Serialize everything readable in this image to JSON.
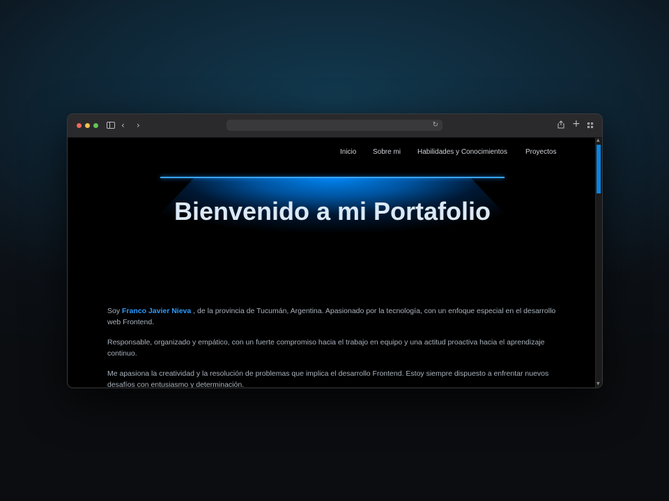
{
  "browser": {
    "url": "",
    "icons": {
      "back": "chevron-left-icon",
      "forward": "chevron-right-icon",
      "sidebar": "sidebar-icon",
      "reload": "reload-icon",
      "share": "share-icon",
      "new_tab": "plus-icon",
      "tab_overview": "tab-overview-icon"
    }
  },
  "nav": {
    "items": [
      "Inicio",
      "Sobre mi",
      "Habilidades y Conocimientos",
      "Proyectos"
    ]
  },
  "hero": {
    "title": "Bienvenido a mi Portafolio",
    "accent_color": "#1e90ff"
  },
  "about": {
    "p1_prefix": "Soy ",
    "p1_name": "Franco Javier Nieva",
    "p1_suffix": " , de la provincia de Tucumán, Argentina. Apasionado por la tecnología, con un enfoque especial en el desarrollo web Frontend.",
    "p2": "Responsable, organizado y empático, con un fuerte compromiso hacia el trabajo en equipo y una actitud proactiva hacia el aprendizaje continuo.",
    "p3": "Me apasiona la creatividad y la resolución de problemas que implica el desarrollo Frontend. Estoy siempre dispuesto a enfrentar nuevos desafíos con entusiasmo y determinación."
  },
  "scroll": {
    "position": 0.0
  }
}
